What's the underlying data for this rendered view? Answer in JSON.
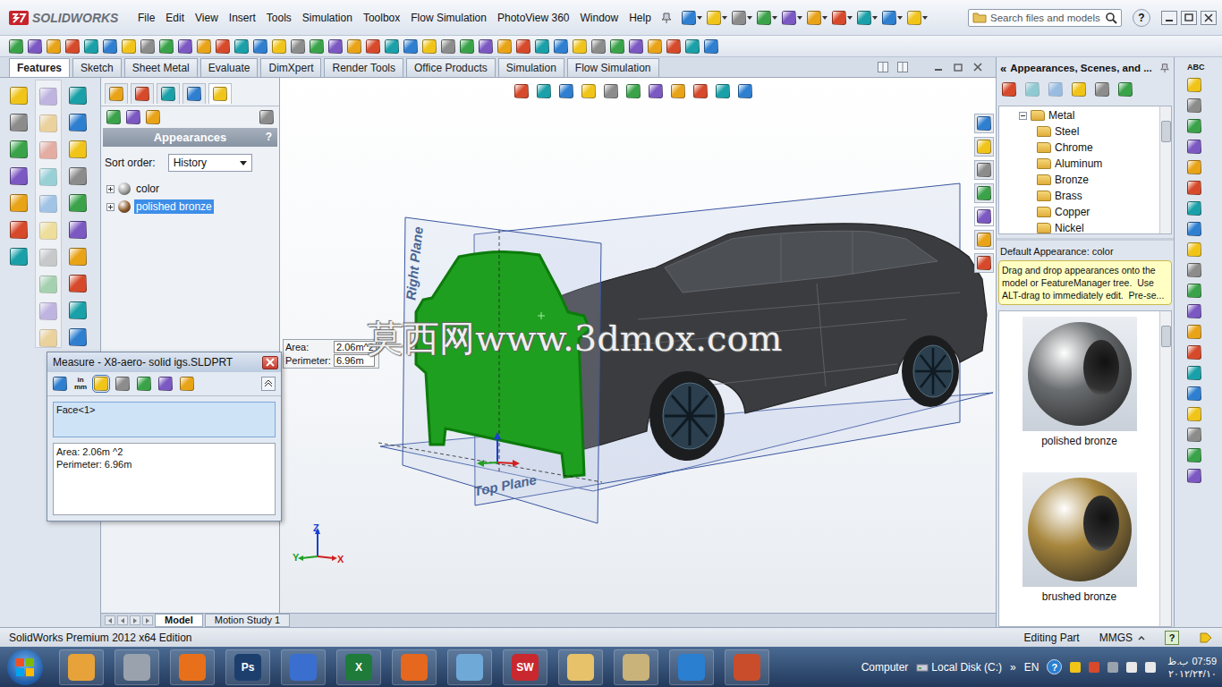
{
  "app": {
    "logo": "SOLIDWORKS",
    "menu": [
      "File",
      "Edit",
      "View",
      "Insert",
      "Tools",
      "Simulation",
      "Toolbox",
      "Flow Simulation",
      "PhotoView 360",
      "Window",
      "Help"
    ],
    "search": {
      "placeholder": "Search files and models"
    },
    "help": "?"
  },
  "command_tabs": [
    {
      "label": "Features",
      "selected": true
    },
    {
      "label": "Sketch",
      "selected": false
    },
    {
      "label": "Sheet Metal",
      "selected": false
    },
    {
      "label": "Evaluate",
      "selected": false
    },
    {
      "label": "DimXpert",
      "selected": false
    },
    {
      "label": "Render Tools",
      "selected": false
    },
    {
      "label": "Office Products",
      "selected": false
    },
    {
      "label": "Simulation",
      "selected": false
    },
    {
      "label": "Flow Simulation",
      "selected": false
    }
  ],
  "feature_panel": {
    "title": "Appearances",
    "help": "?",
    "sort_label": "Sort order:",
    "sort_value": "History",
    "items": [
      {
        "label": "color",
        "selected": false,
        "expanded": false,
        "color": "#9c9c9c"
      },
      {
        "label": "polished bronze",
        "selected": true,
        "expanded": false,
        "color": "#8b5a2b"
      }
    ]
  },
  "viewport": {
    "planes": {
      "right": "Right Plane",
      "top": "Top Plane"
    },
    "face_selected": true,
    "callout": [
      {
        "label": "Area:",
        "value": "2.06m^2"
      },
      {
        "label": "Perimeter:",
        "value": "6.96m"
      }
    ],
    "watermark": "莫西网www.3dmox.com",
    "triad": {
      "x": "X",
      "y": "Y",
      "z": "Z"
    }
  },
  "measure": {
    "title": "Measure - X8-aero- solid igs.SLDPRT",
    "units": [
      "in",
      "mm"
    ],
    "selection": [
      "Face<1>"
    ],
    "results": [
      "Area: 2.06m ^2",
      "Perimeter: 6.96m"
    ]
  },
  "bottom_tabs": [
    {
      "label": "Model",
      "selected": true
    },
    {
      "label": "Motion Study 1",
      "selected": false
    }
  ],
  "task_pane": {
    "collapse": "«",
    "title": "Appearances, Scenes, and ...",
    "tree": {
      "folder": "Metal",
      "expanded": true,
      "items": [
        "Steel",
        "Chrome",
        "Aluminum",
        "Bronze",
        "Brass",
        "Copper",
        "Nickel"
      ]
    },
    "default_label": "Default Appearance: color",
    "tip_lines": [
      "Drag and drop appearances onto the",
      "model or FeatureManager tree.  Use",
      "ALT-drag to immediately edit.  Pre-se..."
    ],
    "swatches": [
      {
        "label": "polished bronze",
        "color": "#6a6d70"
      },
      {
        "label": "brushed bronze",
        "color": "#a8873e"
      }
    ]
  },
  "right_toolbar": {
    "label": "ABC"
  },
  "status_bar": {
    "edition": "SolidWorks Premium 2012 x64 Edition",
    "mode": "Editing Part",
    "units": "MMGS",
    "help": "?"
  },
  "taskbar": {
    "apps": [
      {
        "mark": "",
        "color": "#e7a33a"
      },
      {
        "mark": "",
        "color": "#9aa3ad"
      },
      {
        "mark": "",
        "color": "#e8701a"
      },
      {
        "mark": "Ps",
        "color": "#1c3f6e"
      },
      {
        "mark": "",
        "color": "#3a6fd0"
      },
      {
        "mark": "X",
        "color": "#1e7b3a"
      },
      {
        "mark": "",
        "color": "#e6671e"
      },
      {
        "mark": "",
        "color": "#6fa9d8"
      },
      {
        "mark": "SW",
        "color": "#c8282e"
      },
      {
        "mark": "",
        "color": "#e8c26b"
      },
      {
        "mark": "",
        "color": "#c9b37a"
      },
      {
        "mark": "",
        "color": "#2a7fd0"
      },
      {
        "mark": "",
        "color": "#c94d2a"
      }
    ],
    "tray": {
      "computer": "Computer",
      "drive": "Local Disk (C:)",
      "more": "»",
      "lang": "EN",
      "help": "?",
      "time": "07:59",
      "period": "ب.ظ",
      "date": "۲۰۱۲/۲۴/۱۰"
    }
  }
}
